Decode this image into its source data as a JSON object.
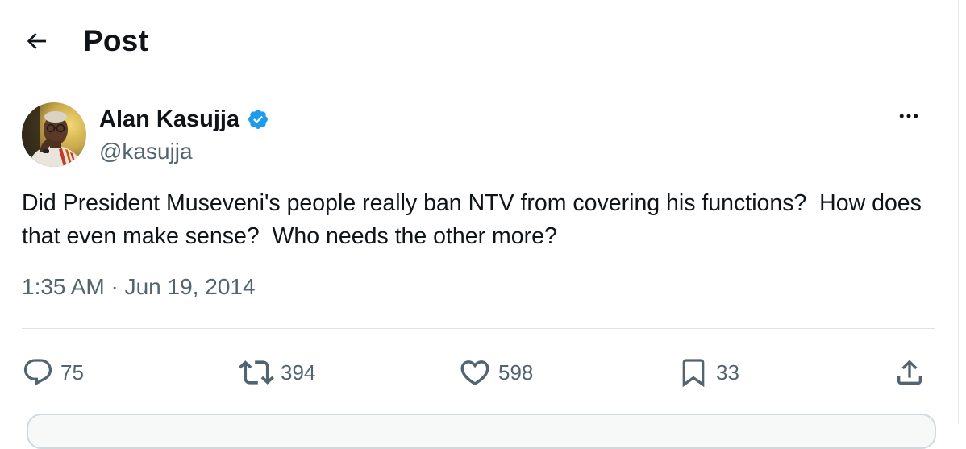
{
  "header": {
    "title": "Post"
  },
  "tweet": {
    "author_name": "Alan Kasujja",
    "author_handle": "@kasujja",
    "text": "Did President Museveni's people really ban NTV from covering his functions?  How does that even make sense?  Who needs the other more?",
    "timestamp": "1:35 AM · Jun 19, 2014"
  },
  "actions": {
    "replies": "75",
    "reposts": "394",
    "likes": "598",
    "bookmarks": "33"
  },
  "colors": {
    "text": "#0f1419",
    "secondary": "#536471",
    "verified": "#1d9bf0",
    "divider": "#dfe3e6"
  },
  "icons": [
    "back-arrow-icon",
    "verified-badge-icon",
    "more-icon",
    "reply-icon",
    "repost-icon",
    "like-icon",
    "bookmark-icon",
    "share-icon"
  ]
}
